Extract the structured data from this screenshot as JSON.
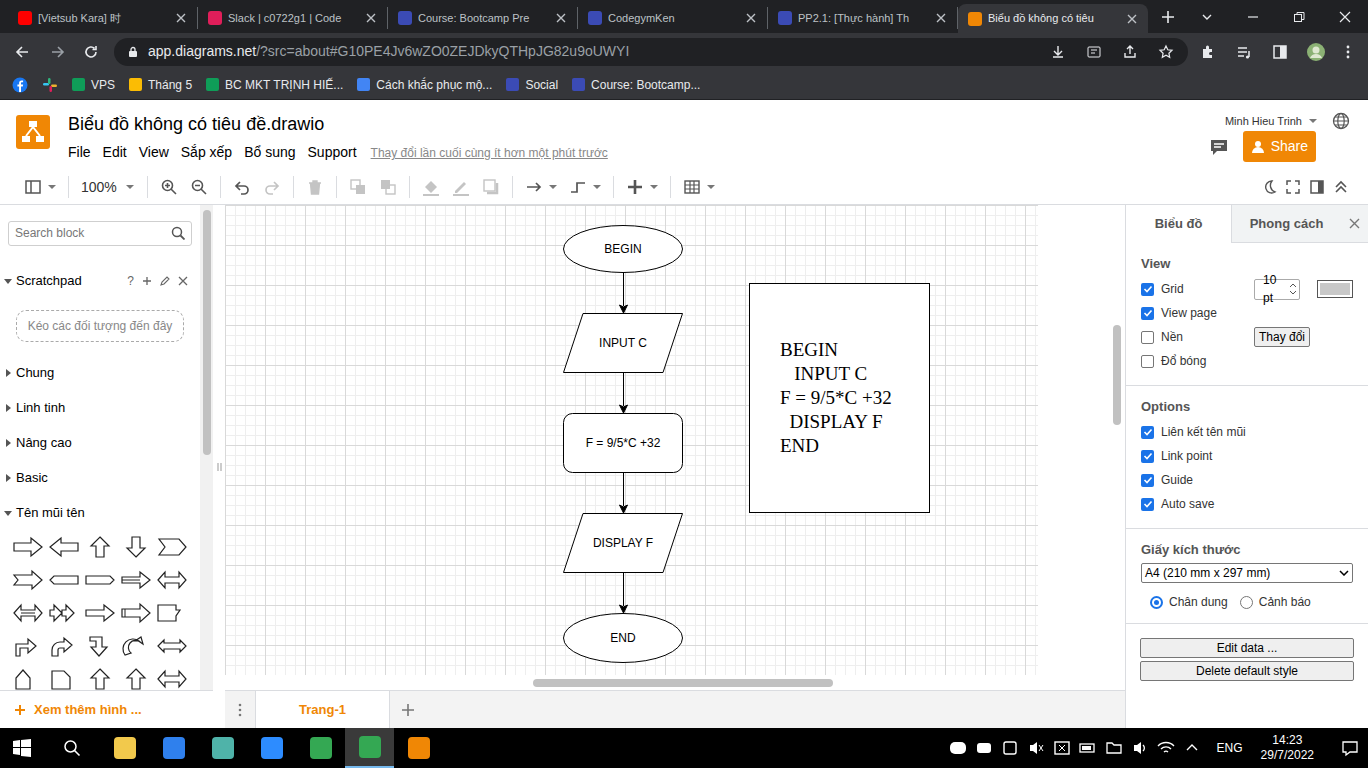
{
  "browser": {
    "tabs": [
      {
        "label": "[Vietsub Kara] 时",
        "selected": false,
        "color": "#ff0000"
      },
      {
        "label": "Slack | c0722g1 | Code",
        "selected": false,
        "color": "#e01e5a"
      },
      {
        "label": "Course: Bootcamp Pre",
        "selected": false,
        "color": "#3b4bb5"
      },
      {
        "label": "CodegymKen",
        "selected": false,
        "color": "#3b4bb5"
      },
      {
        "label": "PP2.1: [Thực hành] Th",
        "selected": false,
        "color": "#3b4bb5"
      },
      {
        "label": "Biểu đồ không có tiêu",
        "selected": true,
        "color": "#f08705"
      }
    ],
    "url": {
      "host": "app.diagrams.net",
      "rest": "/?src=about#G10PE4Jv6wZO0ZEJDkyQTHpJG82u9oUWYI"
    },
    "bookmarks": [
      {
        "label": "VPS",
        "color": "#0f9d58"
      },
      {
        "label": "Tháng 5",
        "color": "#fbbc04"
      },
      {
        "label": "BC MKT TRỊNH HIẾ...",
        "color": "#0f9d58"
      },
      {
        "label": "Cách khắc phục mộ...",
        "color": "#4285f4"
      },
      {
        "label": "Social",
        "color": "#3b4bb5"
      },
      {
        "label": "Course: Bootcamp...",
        "color": "#3b4bb5"
      }
    ]
  },
  "app": {
    "title": "Biểu đồ không có tiêu đề.drawio",
    "menu": [
      "File",
      "Edit",
      "View",
      "Sắp xếp",
      "Bổ sung",
      "Support"
    ],
    "last_saved": "Thay đổi lần cuối cùng ít hơn một phút trước",
    "user": "Minh Hieu Trinh",
    "share": "Share"
  },
  "toolbar": {
    "zoom": "100%",
    "buttons": [
      {
        "disabled": false
      },
      {
        "disabled": false
      },
      {
        "disabled": false
      },
      {
        "disabled": false
      },
      {
        "disabled": true
      },
      {
        "disabled": true
      },
      {
        "disabled": true
      },
      {
        "disabled": true
      },
      {
        "disabled": true
      },
      {
        "disabled": true
      },
      {
        "disabled": true
      },
      {
        "disabled": false
      },
      {
        "disabled": false
      },
      {
        "disabled": false
      },
      {
        "disabled": false
      }
    ]
  },
  "sidebar": {
    "search": {
      "placeholder": "Search block"
    },
    "scratchpad": {
      "title": "Scratchpad",
      "help": "?",
      "expanded": true,
      "hint": "Kéo các đối tượng đến đây"
    },
    "sections": [
      {
        "label": "Chung",
        "expanded": false
      },
      {
        "label": "Linh tinh",
        "expanded": false
      },
      {
        "label": "Nâng cao",
        "expanded": false
      },
      {
        "label": "Basic",
        "expanded": false
      },
      {
        "label": "Tên mũi tên",
        "expanded": true
      }
    ],
    "more": "Xem thêm hình ..."
  },
  "diagram": {
    "nodes": [
      {
        "label": "BEGIN",
        "kind": "ellipse"
      },
      {
        "label": "INPUT C",
        "kind": "parallelogram"
      },
      {
        "label": "F = 9/5*C +32",
        "kind": "rounded"
      },
      {
        "label": "DISPLAY F",
        "kind": "parallelogram"
      },
      {
        "label": "END",
        "kind": "ellipse"
      }
    ],
    "note": [
      "BEGIN",
      "   INPUT C",
      "F = 9/5*C +32",
      "  DISPLAY F",
      "END"
    ]
  },
  "pages": {
    "tabs": [
      {
        "label": "Trang-1",
        "selected": true
      }
    ]
  },
  "format_panel": {
    "tabs": [
      {
        "label": "Biểu đồ",
        "selected": true
      },
      {
        "label": "Phong cách",
        "selected": false
      }
    ],
    "view": {
      "title": "View",
      "items": [
        {
          "label": "Grid",
          "checked": true,
          "kind": "spinner",
          "value": "10 pt",
          "color": "#c8c8c8"
        },
        {
          "label": "View page",
          "checked": true,
          "kind": "plain"
        },
        {
          "label": "Nền",
          "checked": false,
          "kind": "button",
          "button": "Thay đổi"
        },
        {
          "label": "Đổ bóng",
          "checked": false,
          "kind": "plain"
        }
      ]
    },
    "options": {
      "title": "Options",
      "items": [
        {
          "label": "Liên kết tên mũi",
          "checked": true
        },
        {
          "label": "Link point",
          "checked": true
        },
        {
          "label": "Guide",
          "checked": true
        },
        {
          "label": "Auto save",
          "checked": true
        }
      ]
    },
    "paper": {
      "title": "Giấy kích thước",
      "size": "A4 (210 mm x 297 mm)",
      "orientation": [
        {
          "label": "Chân dung",
          "selected": true
        },
        {
          "label": "Cảnh báo",
          "selected": false
        }
      ]
    },
    "buttons": [
      "Edit data ...",
      "Delete default style"
    ]
  },
  "taskbar": {
    "apps": [
      {
        "color": "#f2c94c",
        "selected": false
      },
      {
        "color": "#2f80ed",
        "selected": false
      },
      {
        "color": "#4fb3a9",
        "selected": false
      },
      {
        "color": "#2d8cff",
        "selected": false
      },
      {
        "color": "#34a853",
        "selected": false
      },
      {
        "color": "#34a853",
        "selected": true
      },
      {
        "color": "#f08705",
        "selected": false
      }
    ],
    "lang": "ENG",
    "time": "14:23",
    "date": "29/7/2022"
  }
}
